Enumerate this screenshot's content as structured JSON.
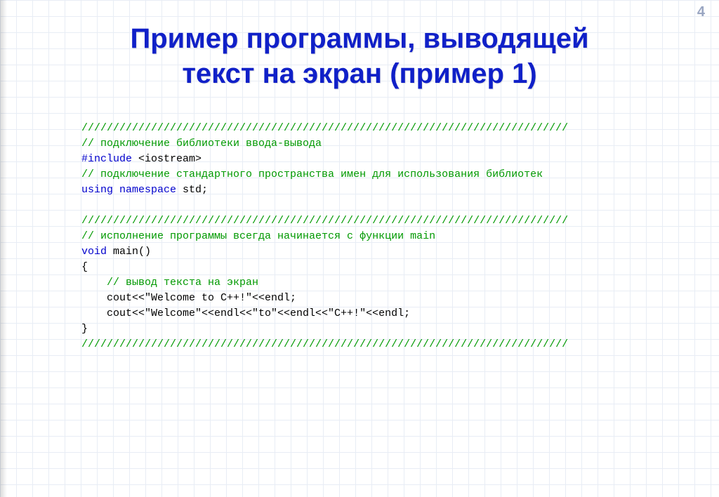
{
  "page_number": "4",
  "title_line1": "Пример программы, выводящей",
  "title_line2": "текст на экран (пример 1)",
  "code": {
    "sep1": "/////////////////////////////////////////////////////////////////////////////",
    "c1": "// подключение библиотеки ввода-вывода",
    "inc_kw": "#include",
    "inc_rest": " <iostream>",
    "c2": "// подключение стандартного пространства имен для использования библиотек",
    "using_kw": "using namespace",
    "using_rest": " std;",
    "sep2": "/////////////////////////////////////////////////////////////////////////////",
    "c3": "// исполнение программы всегда начинается с функции main",
    "void_kw": "void",
    "main_rest": " main()",
    "brace_open": "{",
    "c4": "    // вывод текста на экран",
    "cout1": "    cout<<\"Welcome to C++!\"<<endl;",
    "cout2": "    cout<<\"Welcome\"<<endl<<\"to\"<<endl<<\"C++!\"<<endl;",
    "brace_close": "}",
    "sep3": "/////////////////////////////////////////////////////////////////////////////"
  }
}
